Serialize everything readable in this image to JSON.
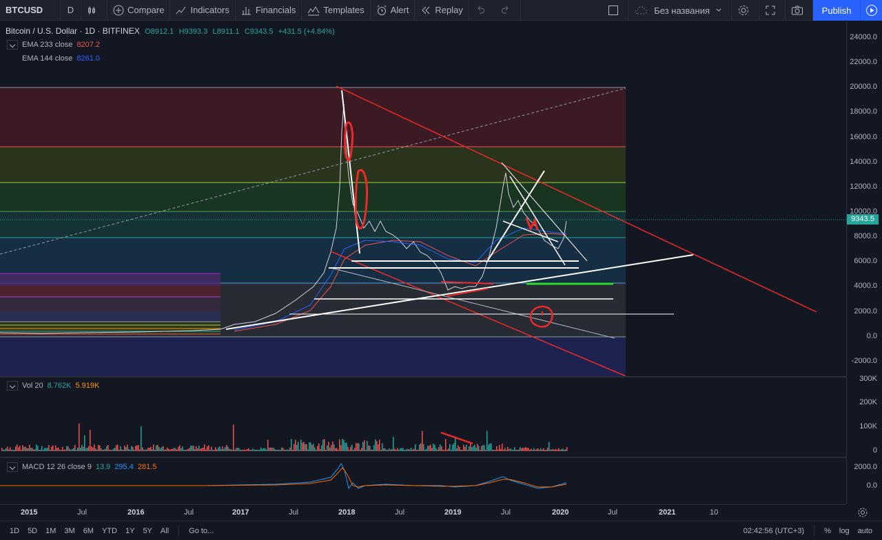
{
  "toolbar": {
    "symbol": "BTCUSD",
    "interval": "D",
    "compare_label": "Compare",
    "indicators_label": "Indicators",
    "financials_label": "Financials",
    "templates_label": "Templates",
    "alert_label": "Alert",
    "replay_label": "Replay",
    "layout_name": "Без названия",
    "publish_label": "Publish"
  },
  "legend": {
    "title": "Bitcoin / U.S. Dollar · 1D · BITFINEX",
    "open": "O8912.1",
    "high": "H9393.3",
    "low": "L8911.1",
    "close": "C9343.5",
    "change": "+431.5 (+4.84%)",
    "ema233_label": "EMA 233 close",
    "ema233_value": "8207.2",
    "ema144_label": "EMA 144 close",
    "ema144_value": "8261.0"
  },
  "volume": {
    "label": "Vol 20",
    "value1": "8.762K",
    "value2": "5.919K",
    "axis_labels": [
      "300K",
      "200K",
      "100K",
      "0"
    ]
  },
  "macd": {
    "label": "MACD 12 26 close 9",
    "value1": "13.9",
    "value2": "295.4",
    "value3": "281.5",
    "axis_labels": [
      "2000.0",
      "0.0"
    ]
  },
  "price_axis": {
    "labels": [
      "24000.0",
      "22000.0",
      "20000.0",
      "18000.0",
      "16000.0",
      "14000.0",
      "12000.0",
      "10000.0",
      "8000.0",
      "6000.0",
      "4000.0",
      "2000.0",
      "0.0",
      "-2000.0"
    ],
    "last_price": "9343.5"
  },
  "time_axis": {
    "labels": [
      "2015",
      "Jul",
      "2016",
      "Jul",
      "2017",
      "Jul",
      "2018",
      "Jul",
      "2019",
      "Jul",
      "2020",
      "Jul",
      "2021",
      "10"
    ]
  },
  "bottom_bar": {
    "ranges": [
      "1D",
      "5D",
      "1M",
      "3M",
      "6M",
      "YTD",
      "1Y",
      "5Y",
      "All"
    ],
    "goto_label": "Go to...",
    "clock": "02:42:56 (UTC+3)",
    "percent_label": "%",
    "log_label": "log",
    "auto_label": "auto"
  },
  "colors": {
    "bg": "#131722",
    "up": "#26a69a",
    "down": "#ef5350",
    "accent": "#2962ff",
    "ema233": "#ef5350",
    "ema144": "#2962ff",
    "vol_value2": "#ff9800"
  }
}
